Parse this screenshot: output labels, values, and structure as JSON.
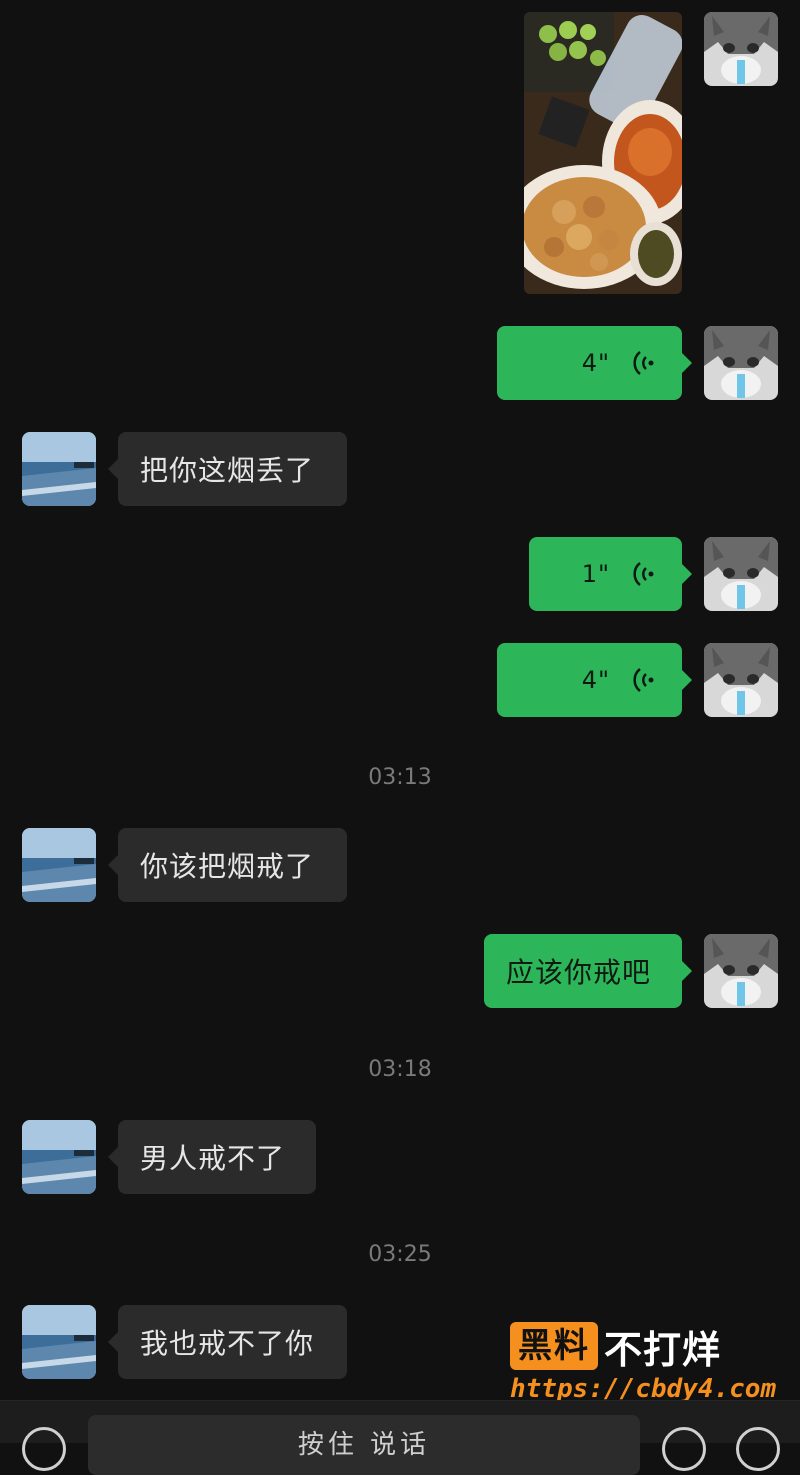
{
  "messages": {
    "voice1_duration": "4\"",
    "text1": "把你这烟丢了",
    "voice2_duration": "1\"",
    "voice3_duration": "4\"",
    "time1": "03:13",
    "text2": "你该把烟戒了",
    "text3": "应该你戒吧",
    "time2": "03:18",
    "text4": "男人戒不了",
    "time3": "03:25",
    "text5": "我也戒不了你"
  },
  "input_bar": {
    "hold_to_talk": "按住 说话"
  },
  "watermark": {
    "brand_box": "黑料",
    "brand_text": "不打烊",
    "url": "https://cbdy4.com"
  },
  "colors": {
    "sent_bubble": "#2db55a",
    "received_bubble": "#2b2b2b",
    "background": "#111111",
    "watermark_accent": "#f5901f"
  }
}
